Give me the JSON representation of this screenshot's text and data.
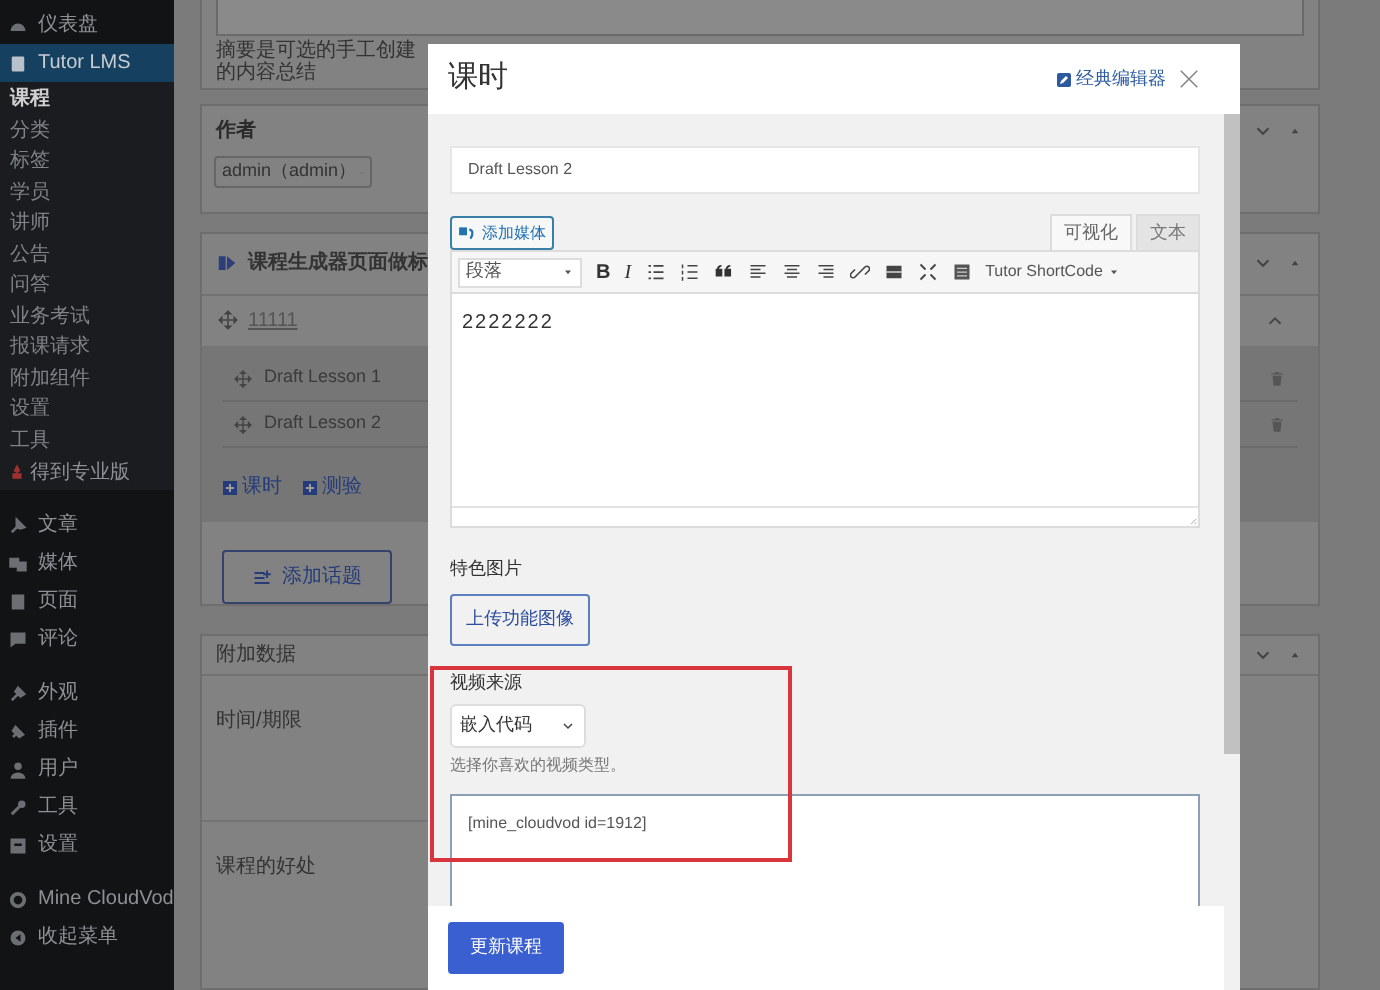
{
  "sidebar": {
    "groups": [
      [
        {
          "label": "仪表盘",
          "selected": false
        },
        {
          "label": "Tutor LMS",
          "selected": true,
          "children": [
            {
              "label": "课程",
              "selected": true
            },
            {
              "label": "分类",
              "selected": false
            },
            {
              "label": "标签",
              "selected": false
            },
            {
              "label": "学员",
              "selected": false
            },
            {
              "label": "讲师",
              "selected": false
            },
            {
              "label": "公告",
              "selected": false
            },
            {
              "label": "问答",
              "selected": false
            },
            {
              "label": "业务考试",
              "selected": false
            },
            {
              "label": "报课请求",
              "selected": false
            },
            {
              "label": "附加组件",
              "selected": false
            },
            {
              "label": "设置",
              "selected": false
            },
            {
              "label": "工具",
              "selected": false
            }
          ],
          "upgrade": "得到专业版"
        }
      ],
      [
        {
          "label": "文章",
          "selected": false
        },
        {
          "label": "媒体",
          "selected": false
        },
        {
          "label": "页面",
          "selected": false
        },
        {
          "label": "评论",
          "selected": false
        }
      ],
      [
        {
          "label": "外观",
          "selected": false
        },
        {
          "label": "插件",
          "selected": false
        },
        {
          "label": "用户",
          "selected": false
        },
        {
          "label": "工具",
          "selected": false
        },
        {
          "label": "设置",
          "selected": false
        }
      ],
      [
        {
          "label": "Mine CloudVod",
          "selected": false
        },
        {
          "label": "收起菜单",
          "selected": false
        }
      ]
    ]
  },
  "background": {
    "excerpt_help": "摘要是可选的手工创建的内容总结",
    "author": {
      "title": "作者",
      "value": "admin（admin）"
    },
    "builder": {
      "title": "课程生成器页面做标",
      "topic": "11111",
      "lessons": [
        "Draft Lesson 1",
        "Draft Lesson 2"
      ],
      "links": [
        "课时",
        "测验"
      ],
      "add_topic": "添加话题"
    },
    "additional": {
      "title": "附加数据",
      "fields": [
        "时间/期限",
        "课程的好处"
      ]
    }
  },
  "modal": {
    "title": "课时",
    "classic_editor": "经典编辑器",
    "lesson_title": "Draft Lesson 2",
    "add_media": "添加媒体",
    "editor_tabs": [
      {
        "label": "可视化",
        "selected": true
      },
      {
        "label": "文本",
        "selected": false
      }
    ],
    "format_select": "段落",
    "format_glyphs": [
      "B",
      "I"
    ],
    "shortcode_menu": "Tutor ShortCode",
    "content": "2222222",
    "featured_image": {
      "label": "特色图片",
      "button": "上传功能图像"
    },
    "video": {
      "label": "视频来源",
      "source": "嵌入代码",
      "help": "选择你喜欢的视频类型。",
      "code": "[mine_cloudvod id=1912]"
    },
    "update_button": "更新课程"
  }
}
